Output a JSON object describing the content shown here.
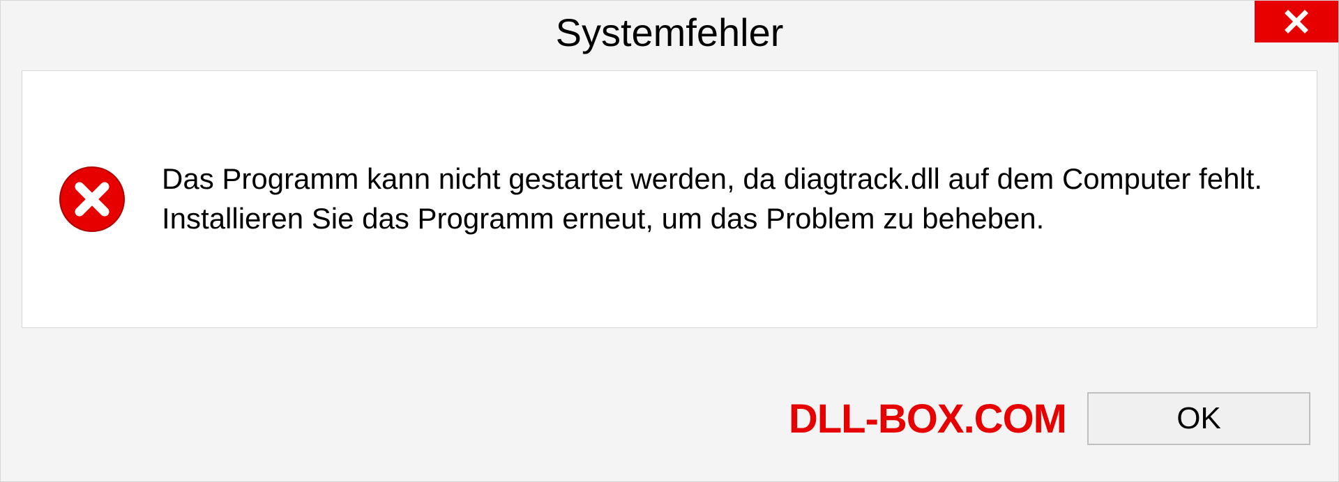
{
  "dialog": {
    "title": "Systemfehler",
    "message": "Das Programm kann nicht gestartet werden, da diagtrack.dll auf dem Computer fehlt. Installieren Sie das Programm erneut, um das Problem zu beheben.",
    "ok_label": "OK"
  },
  "watermark": "DLL-BOX.COM"
}
